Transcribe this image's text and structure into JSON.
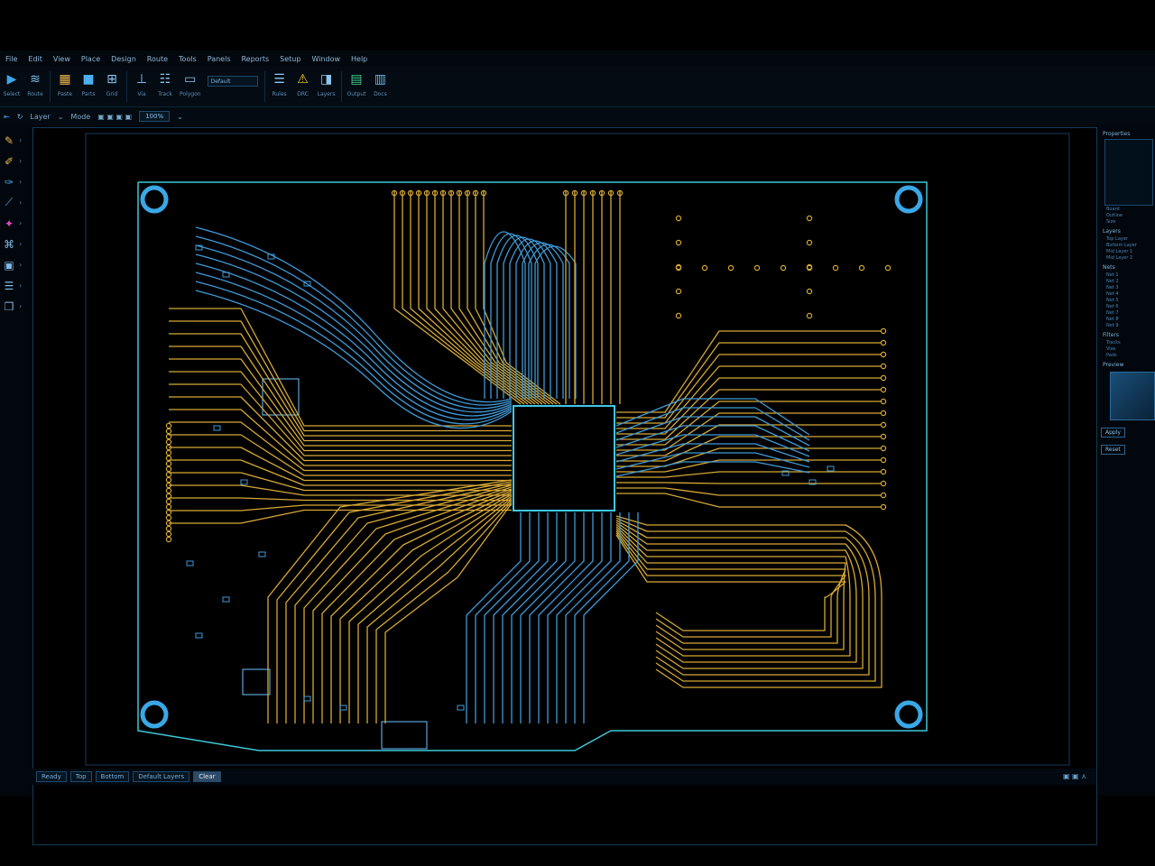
{
  "menu": [
    "File",
    "Edit",
    "View",
    "Place",
    "Design",
    "Route",
    "Tools",
    "Panels",
    "Reports",
    "Setup",
    "Window",
    "Help"
  ],
  "ribbon": {
    "groups": [
      {
        "icon": "select-icon",
        "label": "Select"
      },
      {
        "icon": "route-icon",
        "label": "Route"
      },
      {
        "icon": "paste-icon",
        "label": "Paste"
      },
      {
        "icon": "component-icon",
        "label": "Parts"
      },
      {
        "icon": "grid-icon",
        "label": "Grid"
      },
      {
        "icon": "via-icon",
        "label": "Via"
      },
      {
        "icon": "track-icon",
        "label": "Track"
      },
      {
        "icon": "polygon-icon",
        "label": "Polygon"
      },
      {
        "icon": "rule-icon",
        "label": "Rules"
      },
      {
        "icon": "drc-warning-icon",
        "label": "DRC"
      },
      {
        "icon": "layer-icon",
        "label": "Layers"
      },
      {
        "icon": "output-icon",
        "label": "Output"
      },
      {
        "icon": "doc-icon",
        "label": "Docs"
      }
    ],
    "combo_value": "Default"
  },
  "toolbar2": {
    "layer_label": "Layer",
    "mode_label": "Mode",
    "zoom_value": "100%"
  },
  "left_tools": [
    "wire-icon",
    "pencil-icon",
    "brush-icon",
    "measure-icon",
    "highlight-icon",
    "net-icon",
    "component-icon",
    "stack-icon",
    "copy-icon"
  ],
  "right_panel": {
    "sections": [
      {
        "title": "Properties",
        "lines": [
          "Board",
          "Outline",
          "Size"
        ]
      },
      {
        "title": "Layers",
        "lines": [
          "Top Layer",
          "Bottom Layer",
          "Mid Layer 1",
          "Mid Layer 2"
        ]
      },
      {
        "title": "Nets",
        "lines": [
          "Net 1",
          "Net 2",
          "Net 3",
          "Net 4",
          "Net 5",
          "Net 6",
          "Net 7",
          "Net 8",
          "Net 9"
        ]
      },
      {
        "title": "Filters",
        "lines": [
          "Tracks",
          "Vias",
          "Pads"
        ]
      }
    ],
    "preview_title": "Preview",
    "buttons": [
      "Apply",
      "Reset"
    ]
  },
  "status": {
    "items": [
      "Ready",
      "Top",
      "Bottom",
      "Default Layers"
    ],
    "active": "Clear"
  },
  "colors": {
    "trace_top": "#d7a935",
    "trace_bottom": "#3f9ad8",
    "outline": "#3ec8d8",
    "background": "#000000"
  }
}
